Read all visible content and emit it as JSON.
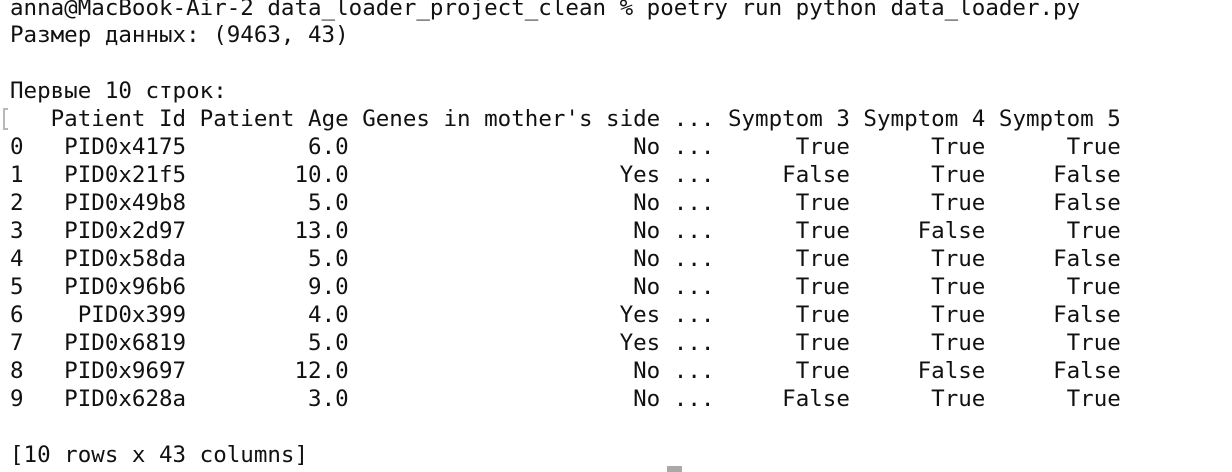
{
  "terminal": {
    "prompt_line": "anna@MacBook-Air-2 data_loader_project_clean % poetry run python data_loader.py",
    "data_size_line": "Размер данных: (9463, 43)",
    "first_rows_heading": "Первые 10 строк:",
    "table": {
      "columns": [
        "Patient Id",
        "Patient Age",
        "Genes in mother's side",
        "...",
        "Symptom 3",
        "Symptom 4",
        "Symptom 5"
      ],
      "rows": [
        {
          "index": "0",
          "patient_id": "PID0x4175",
          "patient_age": "6.0",
          "genes_mother": "No",
          "ellipsis": "...",
          "symptom_3": "True",
          "symptom_4": "True",
          "symptom_5": "True"
        },
        {
          "index": "1",
          "patient_id": "PID0x21f5",
          "patient_age": "10.0",
          "genes_mother": "Yes",
          "ellipsis": "...",
          "symptom_3": "False",
          "symptom_4": "True",
          "symptom_5": "False"
        },
        {
          "index": "2",
          "patient_id": "PID0x49b8",
          "patient_age": "5.0",
          "genes_mother": "No",
          "ellipsis": "...",
          "symptom_3": "True",
          "symptom_4": "True",
          "symptom_5": "False"
        },
        {
          "index": "3",
          "patient_id": "PID0x2d97",
          "patient_age": "13.0",
          "genes_mother": "No",
          "ellipsis": "...",
          "symptom_3": "True",
          "symptom_4": "False",
          "symptom_5": "True"
        },
        {
          "index": "4",
          "patient_id": "PID0x58da",
          "patient_age": "5.0",
          "genes_mother": "No",
          "ellipsis": "...",
          "symptom_3": "True",
          "symptom_4": "True",
          "symptom_5": "False"
        },
        {
          "index": "5",
          "patient_id": "PID0x96b6",
          "patient_age": "9.0",
          "genes_mother": "No",
          "ellipsis": "...",
          "symptom_3": "True",
          "symptom_4": "True",
          "symptom_5": "True"
        },
        {
          "index": "6",
          "patient_id": "PID0x399",
          "patient_age": "4.0",
          "genes_mother": "Yes",
          "ellipsis": "...",
          "symptom_3": "True",
          "symptom_4": "True",
          "symptom_5": "False"
        },
        {
          "index": "7",
          "patient_id": "PID0x6819",
          "patient_age": "5.0",
          "genes_mother": "Yes",
          "ellipsis": "...",
          "symptom_3": "True",
          "symptom_4": "True",
          "symptom_5": "True"
        },
        {
          "index": "8",
          "patient_id": "PID0x9697",
          "patient_age": "12.0",
          "genes_mother": "No",
          "ellipsis": "...",
          "symptom_3": "True",
          "symptom_4": "False",
          "symptom_5": "False"
        },
        {
          "index": "9",
          "patient_id": "PID0x628a",
          "patient_age": "3.0",
          "genes_mother": "No",
          "ellipsis": "...",
          "symptom_3": "False",
          "symptom_4": "True",
          "symptom_5": "True"
        }
      ],
      "summary": "[10 rows x 43 columns]"
    }
  }
}
